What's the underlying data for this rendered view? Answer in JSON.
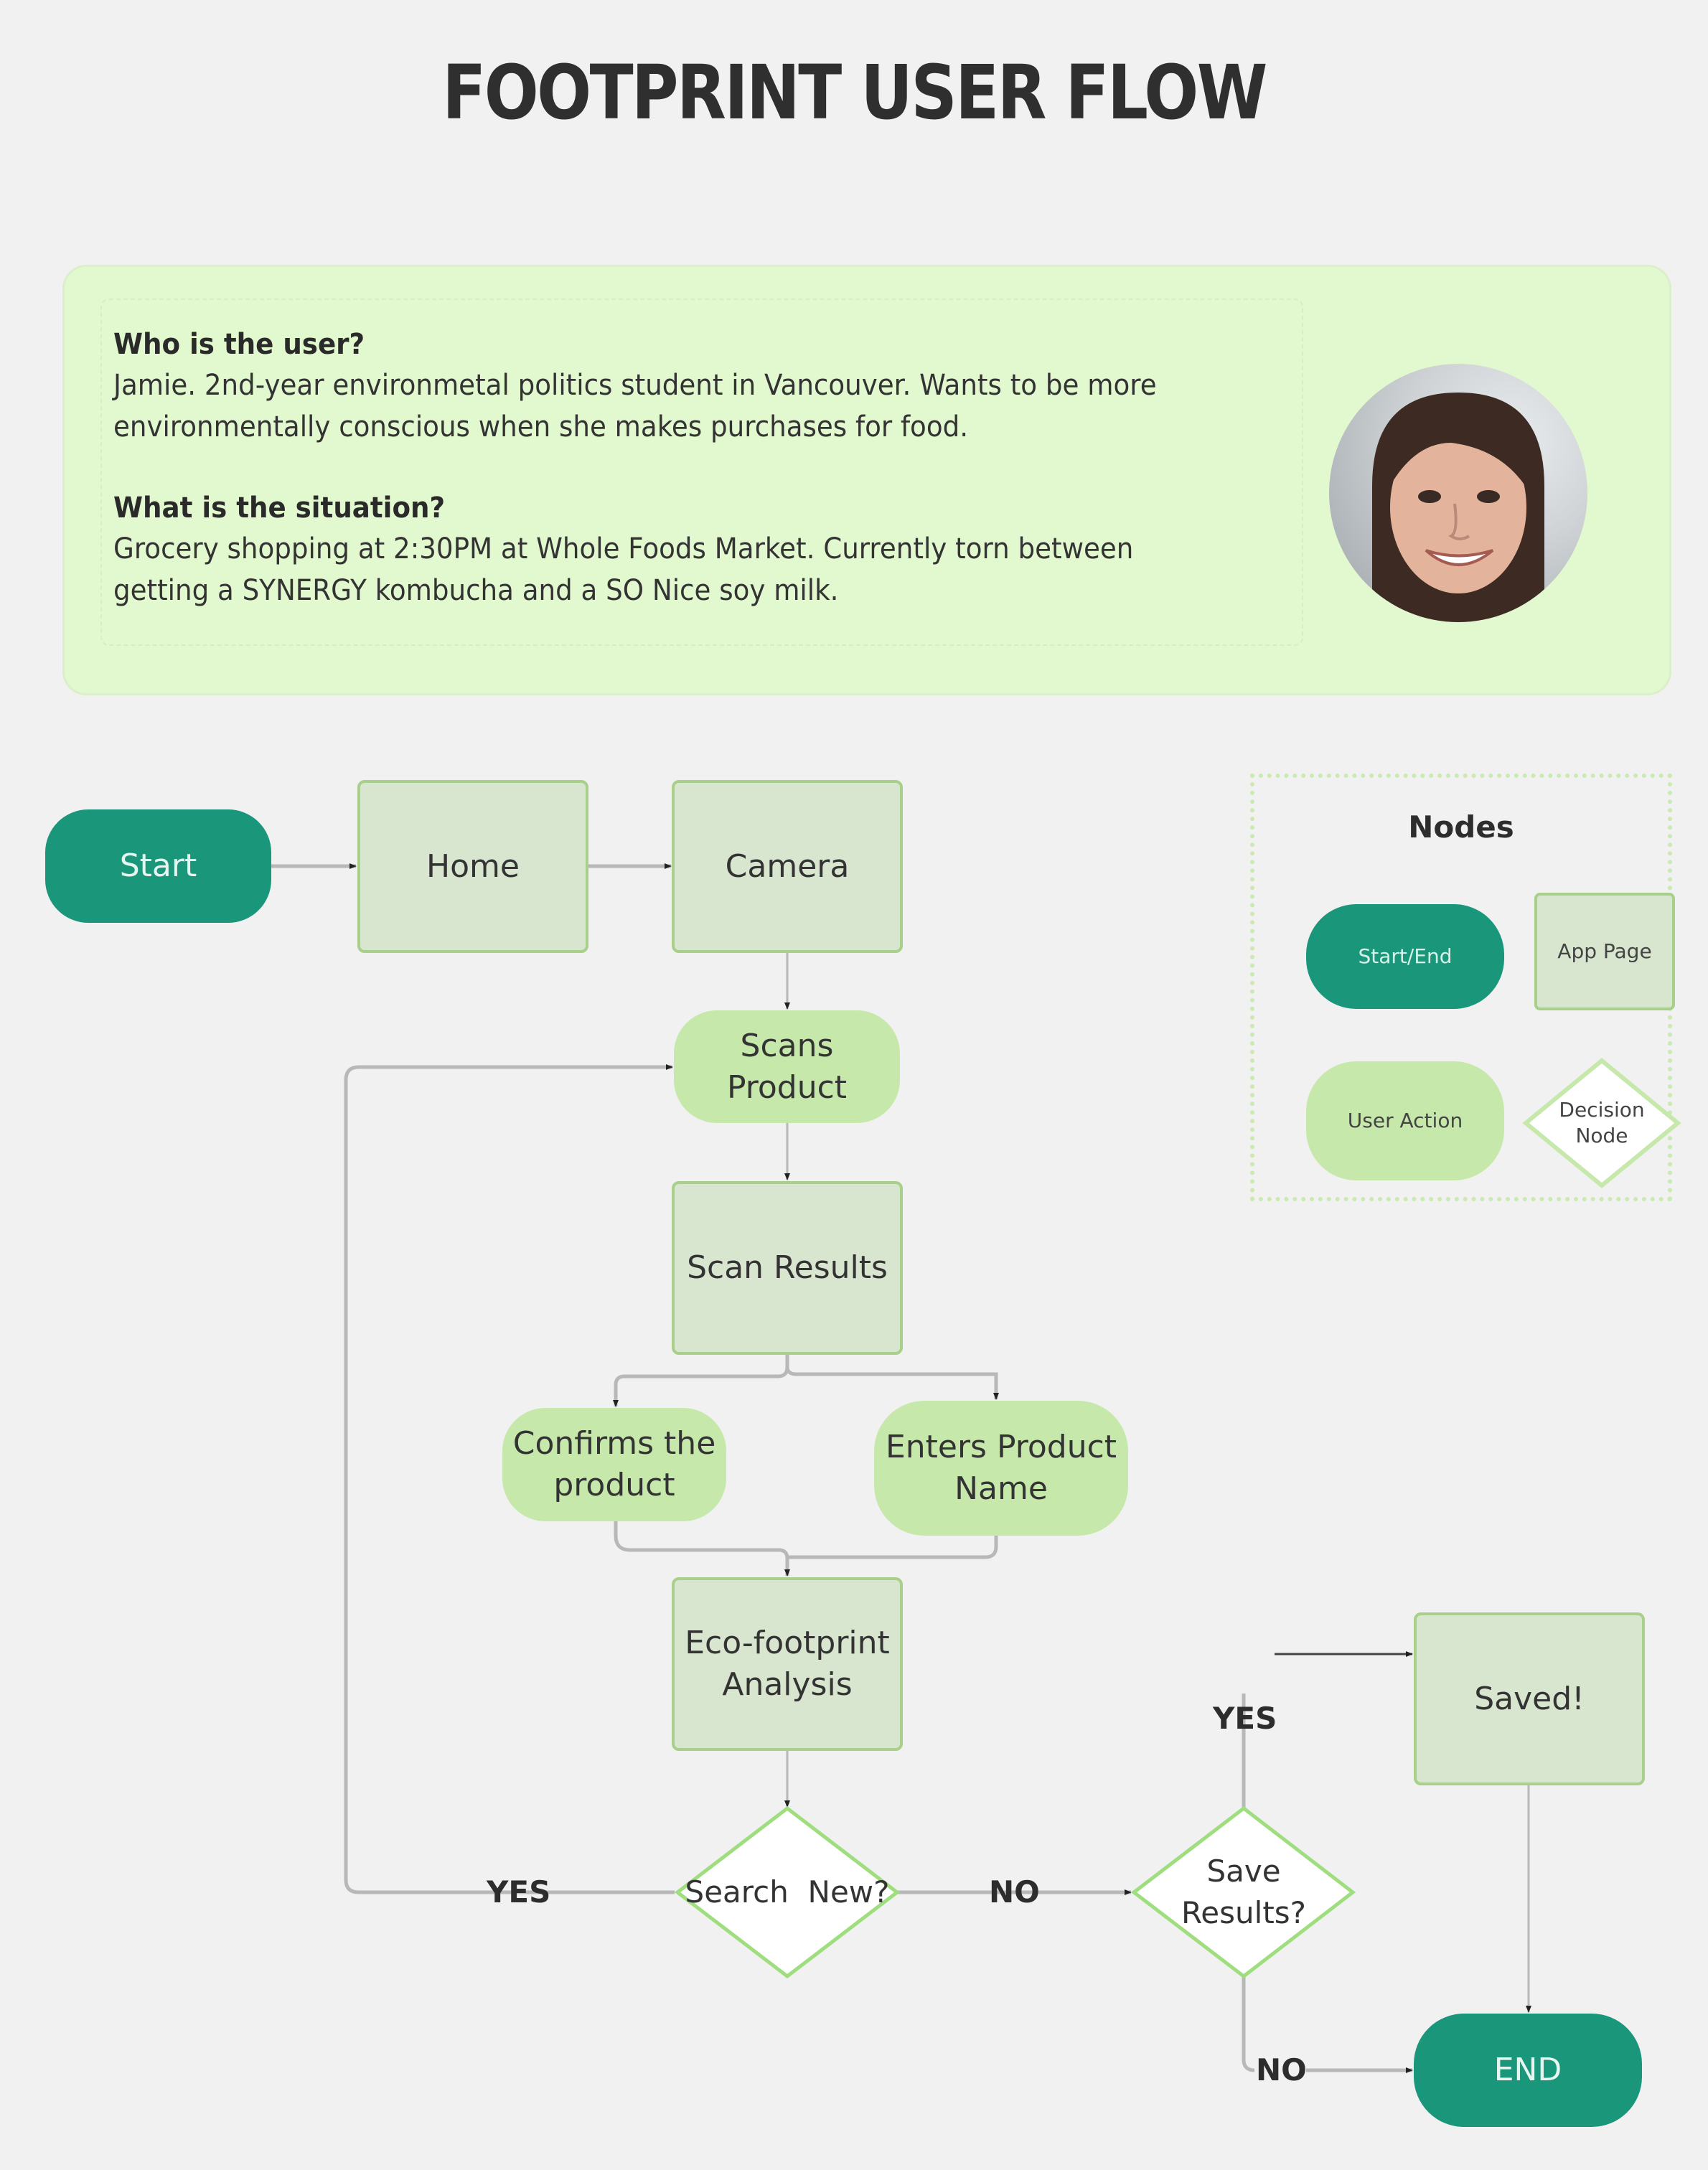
{
  "title": "FOOTPRINT USER FLOW",
  "persona": {
    "q1": "Who is the user?",
    "a1": "Jamie. 2nd-year environmetal politics student in Vancouver. Wants to be more environmentally conscious when she makes purchases for food.",
    "q2": "What is the situation?",
    "a2": "Grocery shopping at 2:30PM at Whole Foods Market. Currently torn between getting a SYNERGY kombucha and a SO Nice soy milk.",
    "avatar_alt": "Jamie portrait photo"
  },
  "colors": {
    "start_end": "#1a967b",
    "app_page_fill": "#d9e6cf",
    "app_page_border": "#a8d08a",
    "user_action": "#c6e9ab",
    "decision_border": "#9fde7e",
    "card_bg": "#e2f8cf",
    "connector": "#b8b8b8"
  },
  "nodes": {
    "start": "Start",
    "home": "Home",
    "camera": "Camera",
    "scans_product": "Scans Product",
    "scan_results": "Scan Results",
    "confirms_product": "Confirms the product",
    "enters_product_name": "Enters Product Name",
    "eco_analysis": "Eco-footprint Analysis",
    "search_new": "Search  New?",
    "save_results": "Save Results?",
    "saved": "Saved!",
    "end": "END"
  },
  "edge_labels": {
    "search_yes": "YES",
    "search_no": "NO",
    "save_yes": "YES",
    "save_no": "NO"
  },
  "legend": {
    "title": "Nodes",
    "items": {
      "start_end": "Start/End",
      "app_page": "App Page",
      "user_action": "User Action",
      "decision": "Decision Node"
    }
  }
}
